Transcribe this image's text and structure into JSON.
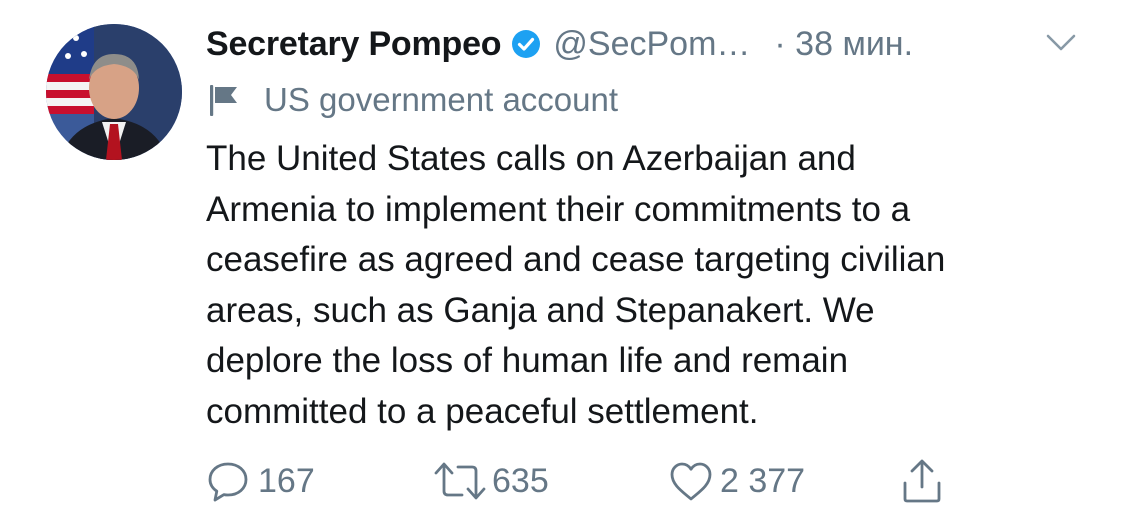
{
  "author": {
    "display_name": "Secretary Pompeo",
    "handle": "@SecPom…",
    "time": "· 38 мин.",
    "verified": true,
    "avatar_icon": "profile-photo-avatar"
  },
  "account_label": {
    "icon": "flag-icon",
    "text": "US government account"
  },
  "tweet": {
    "lines": [
      "The United States calls on Azerbaijan and",
      "Armenia to implement their commitments to a",
      "ceasefire as agreed and cease targeting civilian",
      "areas, such as Ganja and Stepanakert. We",
      "deplore the loss of human life and remain",
      "committed to a peaceful settlement."
    ]
  },
  "actions": {
    "replies": "167",
    "retweets": "635",
    "likes": "2 377"
  },
  "colors": {
    "text": "#14171a",
    "secondary": "#657786",
    "verified_blue": "#1da1f2"
  }
}
